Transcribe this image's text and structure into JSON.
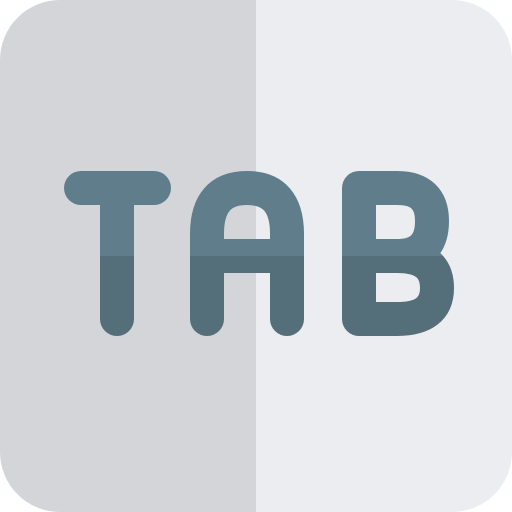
{
  "icon": {
    "name": "tab-key-icon",
    "label": "TAB",
    "colors": {
      "key_left": "#d4d5d8",
      "key_right": "#ecedf0",
      "letters_top": "#607d8b",
      "letters_bottom": "#546e7a"
    }
  }
}
